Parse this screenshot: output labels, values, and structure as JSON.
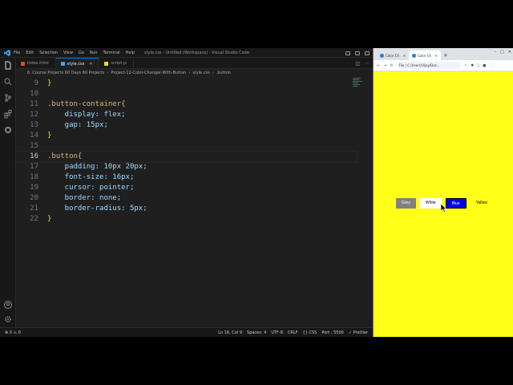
{
  "vscode": {
    "menu": [
      "File",
      "Edit",
      "Selection",
      "View",
      "Go",
      "Run",
      "Terminal",
      "Help"
    ],
    "window_title": "style.css - Untitled (Workspace) - Visual Studio Code",
    "tabs": [
      {
        "label": "index.html",
        "color": "#e44d26",
        "active": false
      },
      {
        "label": "style.css",
        "color": "#42a5f5",
        "active": true
      },
      {
        "label": "script.js",
        "color": "#f5de19",
        "active": false
      }
    ],
    "breadcrumb": [
      "6. Course Projects 60 Days 60 Projects",
      "Project-12-Color-Changer-With-Button",
      "style.css",
      ".button"
    ],
    "code": [
      {
        "n": "9",
        "text": "}"
      },
      {
        "n": "10",
        "text": ""
      },
      {
        "n": "11",
        "text": ".button-container{"
      },
      {
        "n": "12",
        "text": "    display: flex;"
      },
      {
        "n": "13",
        "text": "    gap: 15px;"
      },
      {
        "n": "14",
        "text": "}"
      },
      {
        "n": "15",
        "text": ""
      },
      {
        "n": "16",
        "text": ".button{"
      },
      {
        "n": "17",
        "text": "    padding: 10px 20px;"
      },
      {
        "n": "18",
        "text": "    font-size: 16px;"
      },
      {
        "n": "19",
        "text": "    cursor: pointer;"
      },
      {
        "n": "20",
        "text": "    border: none;"
      },
      {
        "n": "21",
        "text": "    border-radius: 5px;"
      },
      {
        "n": "22",
        "text": "}"
      }
    ],
    "status_left": "⊗ 0 ⚠ 0",
    "status_right": [
      "Ln 16, Col 9",
      "Spaces: 4",
      "UTF-8",
      "CRLF",
      "{} CSS",
      "Port : 5500",
      "✓ Prettier"
    ]
  },
  "browser": {
    "tabs": [
      "Color Ch",
      "Color Ch"
    ],
    "url": "File  |  C:/Users/Vijay/Des...",
    "buttons": [
      "Grey",
      "White",
      "Blue",
      "Yellow"
    ],
    "background": "#ffff18"
  }
}
